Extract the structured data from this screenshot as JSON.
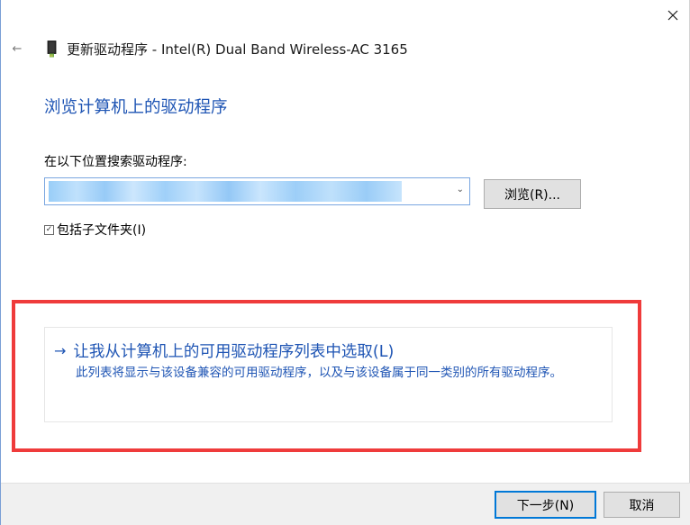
{
  "window": {
    "title": "更新驱动程序 - Intel(R) Dual Band Wireless-AC 3165",
    "back_glyph": "←",
    "close_icon": "close-icon",
    "device_icon": "network-adapter-icon"
  },
  "main": {
    "heading": "浏览计算机上的驱动程序",
    "search_label": "在以下位置搜索驱动程序:",
    "path_value": "",
    "browse_label": "浏览(R)...",
    "include_subfolders": {
      "label": "包括子文件夹(I)",
      "checked": true,
      "check_glyph": "✓"
    },
    "choose_option": {
      "arrow": "→",
      "title": "让我从计算机上的可用驱动程序列表中选取(L)",
      "description": "此列表将显示与该设备兼容的可用驱动程序，以及与该设备属于同一类别的所有驱动程序。"
    }
  },
  "footer": {
    "next_label": "下一步(N)",
    "cancel_label": "取消"
  },
  "colors": {
    "link_blue": "#1f55b4",
    "highlight_red": "#ef3b3b",
    "default_button_border": "#0078d7"
  }
}
